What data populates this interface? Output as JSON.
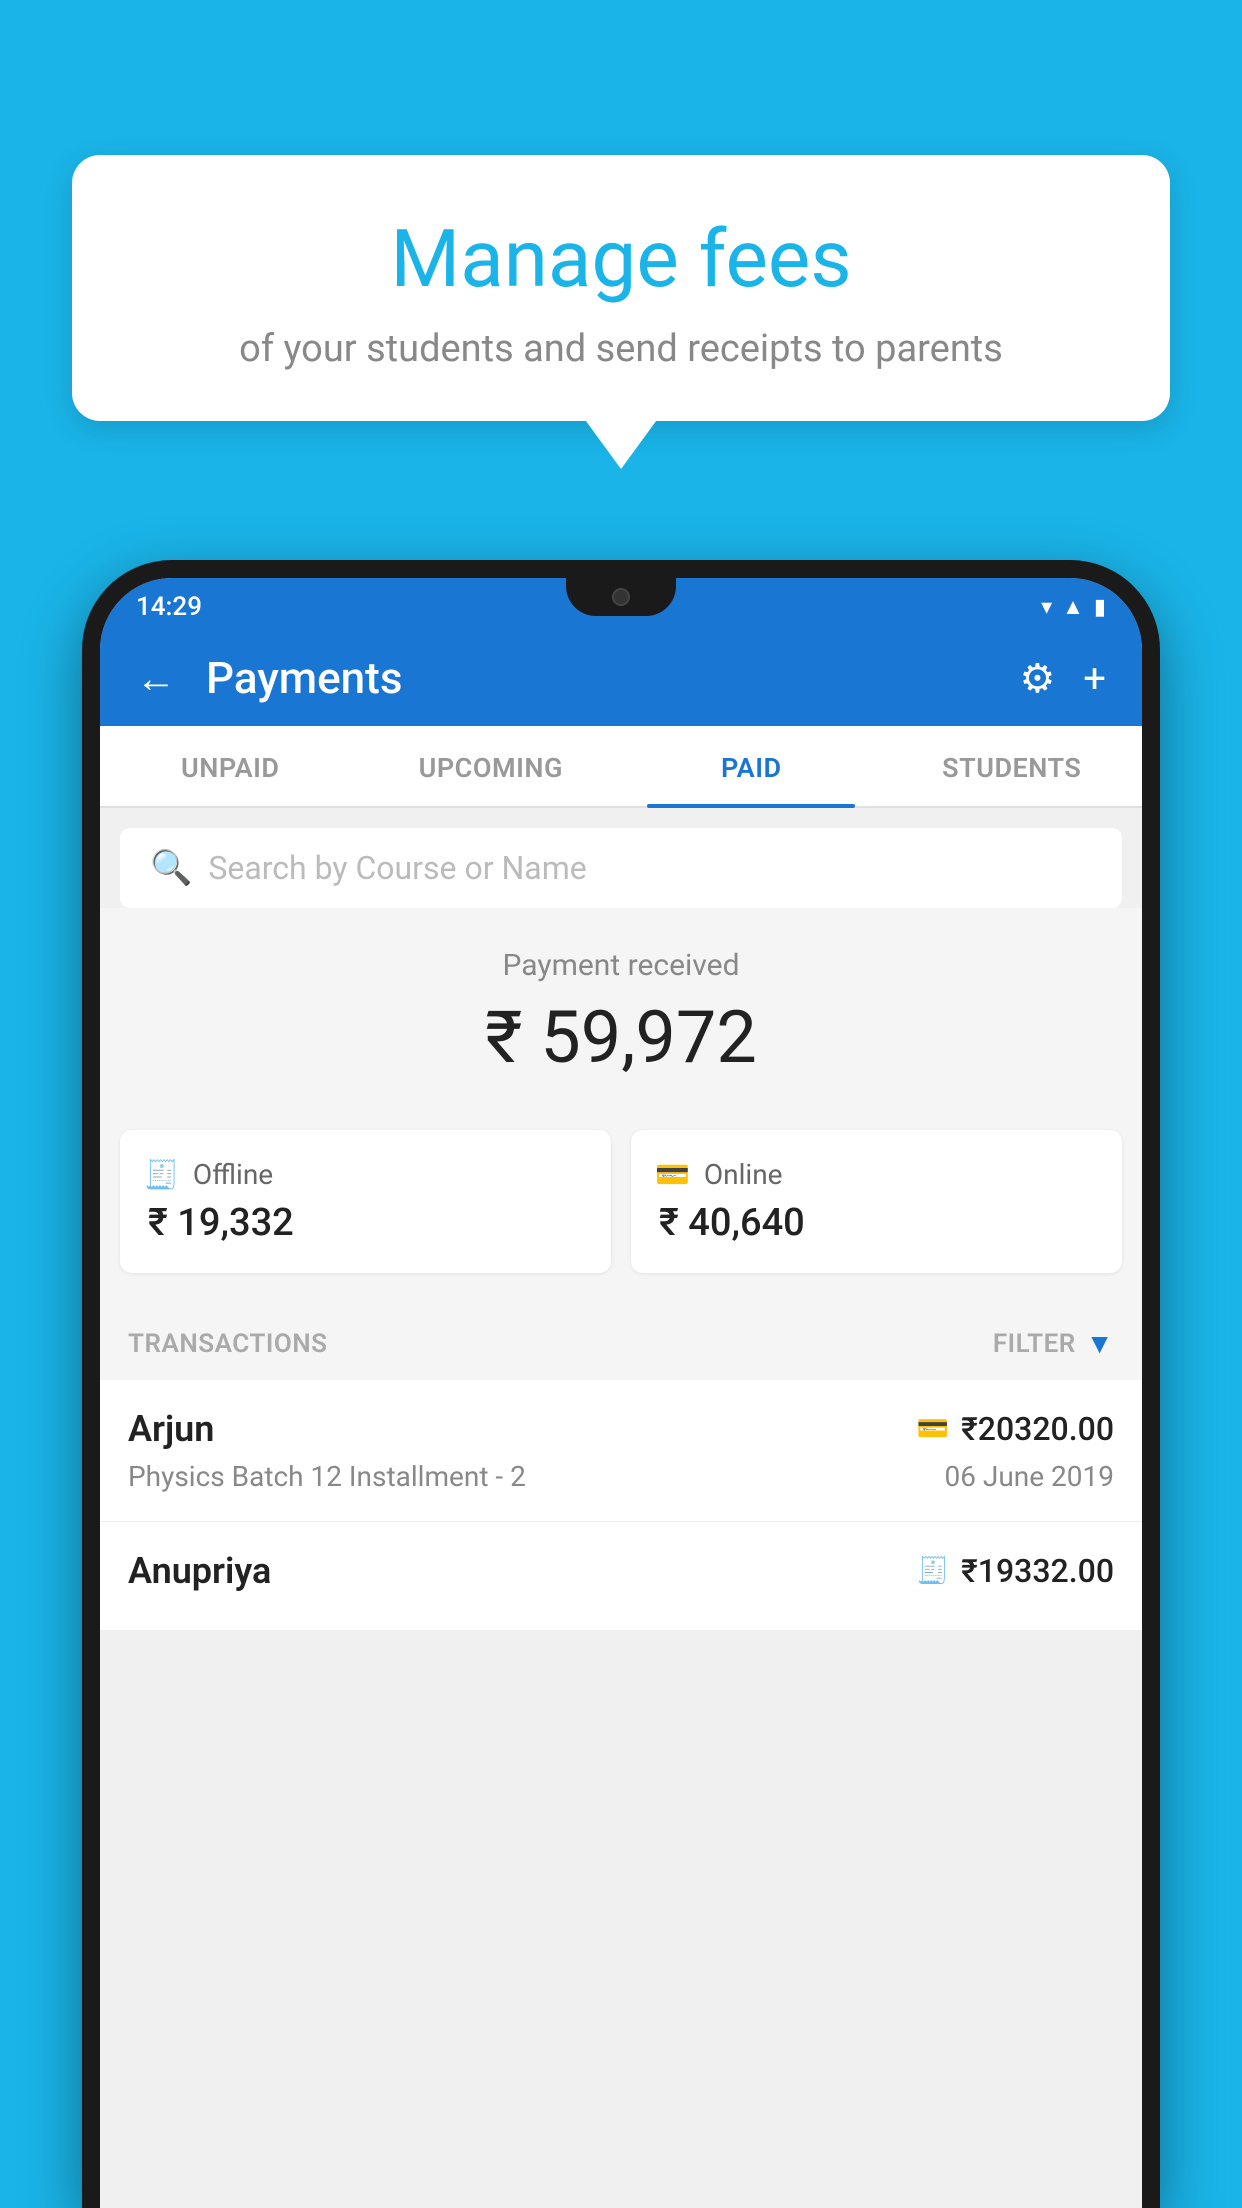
{
  "background_color": "#1ab4e8",
  "speech_bubble": {
    "title": "Manage fees",
    "subtitle": "of your students and send receipts to parents"
  },
  "status_bar": {
    "time": "14:29",
    "icons": [
      "wifi",
      "signal",
      "battery"
    ]
  },
  "header": {
    "title": "Payments",
    "back_label": "←",
    "settings_label": "⚙",
    "add_label": "+"
  },
  "tabs": [
    {
      "label": "UNPAID",
      "active": false
    },
    {
      "label": "UPCOMING",
      "active": false
    },
    {
      "label": "PAID",
      "active": true
    },
    {
      "label": "STUDENTS",
      "active": false
    }
  ],
  "search": {
    "placeholder": "Search by Course or Name"
  },
  "payment_received": {
    "label": "Payment received",
    "amount": "₹ 59,972"
  },
  "payment_cards": [
    {
      "type": "Offline",
      "amount": "₹ 19,332",
      "icon": "💳"
    },
    {
      "type": "Online",
      "amount": "₹ 40,640",
      "icon": "💳"
    }
  ],
  "transactions_section": {
    "label": "TRANSACTIONS",
    "filter_label": "FILTER"
  },
  "transactions": [
    {
      "name": "Arjun",
      "course": "Physics Batch 12 Installment - 2",
      "amount": "₹20320.00",
      "date": "06 June 2019",
      "payment_type": "online"
    },
    {
      "name": "Anupriya",
      "course": "",
      "amount": "₹19332.00",
      "date": "",
      "payment_type": "offline"
    }
  ]
}
